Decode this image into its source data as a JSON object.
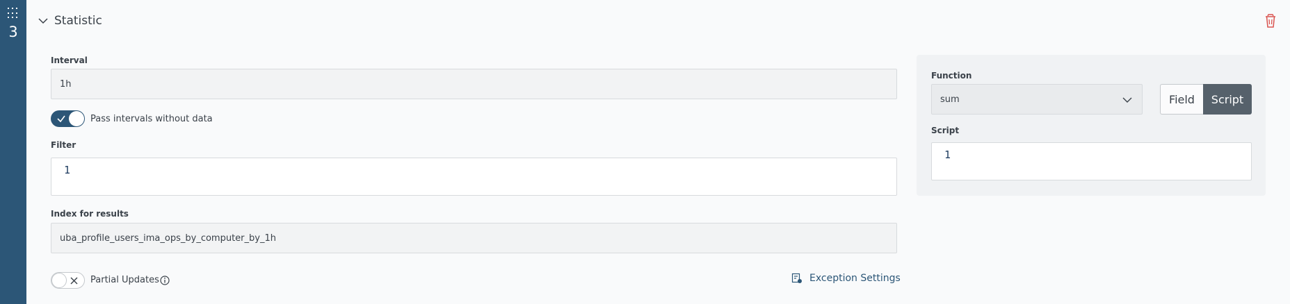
{
  "step": {
    "number": "3"
  },
  "header": {
    "title": "Statistic"
  },
  "form": {
    "interval_label": "Interval",
    "interval_value": "1h",
    "pass_intervals_label": "Pass intervals without data",
    "pass_intervals_on": true,
    "filter_label": "Filter",
    "filter_line": "1",
    "index_label": "Index for results",
    "index_value": "uba_profile_users_ima_ops_by_computer_by_1h",
    "partial_updates_label": "Partial Updates",
    "partial_updates_on": false,
    "exception_settings_label": "Exception Settings"
  },
  "function_panel": {
    "function_label": "Function",
    "function_value": "sum",
    "mode_options": [
      "Field",
      "Script"
    ],
    "mode_selected": "Script",
    "script_label": "Script",
    "script_line": "1"
  },
  "colors": {
    "sidebar": "#2c5677",
    "accent": "#2c5677",
    "danger": "#d9534f",
    "segment_active": "#56616b"
  }
}
